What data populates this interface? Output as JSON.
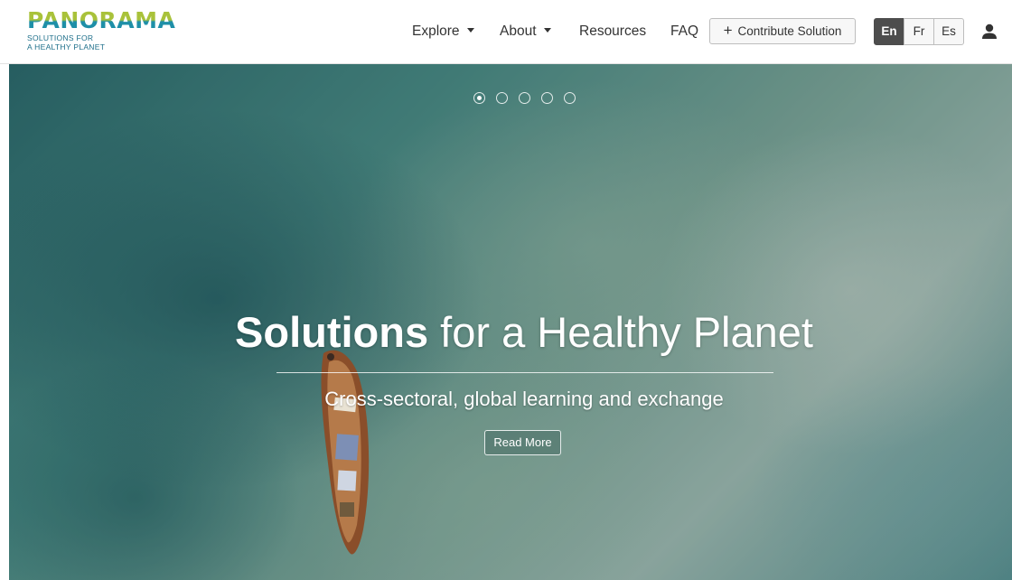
{
  "brand": {
    "name": "PANORAMA",
    "tagline_line1": "SOLUTIONS FOR",
    "tagline_line2": "A HEALTHY PLANET"
  },
  "nav": {
    "explore": "Explore",
    "about": "About",
    "resources": "Resources",
    "faq": "FAQ",
    "contribute": "Contribute Solution"
  },
  "languages": [
    {
      "label": "En",
      "active": true
    },
    {
      "label": "Fr",
      "active": false
    },
    {
      "label": "Es",
      "active": false
    }
  ],
  "hero": {
    "title_bold": "Solutions",
    "title_rest": " for a Healthy Planet",
    "subtitle": "Cross-sectoral, global learning and exchange",
    "cta": "Read More",
    "slide_count": 5,
    "active_slide": 1
  },
  "colors": {
    "logo_green": "#a9c23a",
    "logo_teal": "#1e8fa8",
    "lang_active": "#4d4d4d"
  },
  "icons": {
    "user": "user-icon",
    "plus": "plus-icon",
    "caret": "caret-down-icon"
  }
}
